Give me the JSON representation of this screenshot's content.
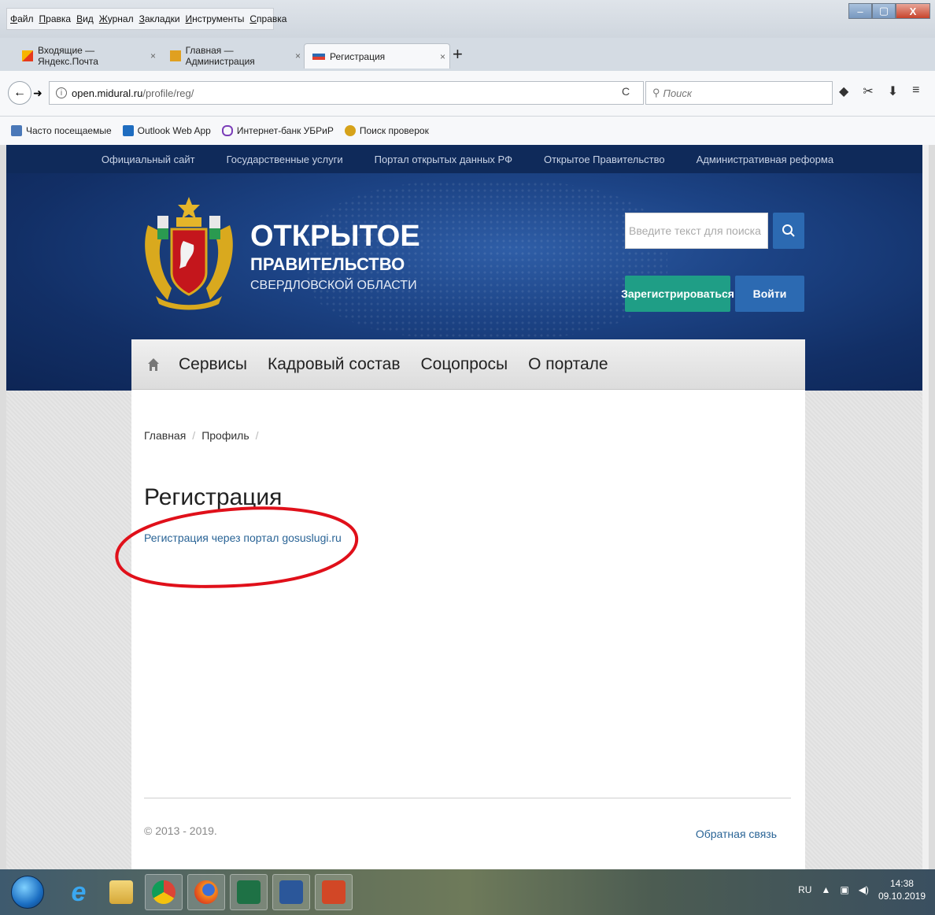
{
  "menu": [
    "Файл",
    "Правка",
    "Вид",
    "Журнал",
    "Закладки",
    "Инструменты",
    "Справка"
  ],
  "tabs": [
    {
      "label": "Входящие — Яндекс.Почта",
      "close": "×"
    },
    {
      "label": "Главная — Администрация",
      "close": "×"
    },
    {
      "label": "Регистрация",
      "close": "×"
    }
  ],
  "new_tab": "+",
  "url": {
    "host": "open.midural.ru",
    "path": "/profile/reg/"
  },
  "search": {
    "placeholder": "Поиск"
  },
  "bookmarks": [
    "Часто посещаемые",
    "Outlook Web App",
    "Интернет-банк УБРиР",
    "Поиск проверок"
  ],
  "topnav": [
    "Официальный сайт",
    "Государственные услуги",
    "Портал открытых данных РФ",
    "Открытое Правительство",
    "Административная реформа"
  ],
  "brand": {
    "title": "ОТКРЫТОЕ",
    "subtitle": "ПРАВИТЕЛЬСТВО",
    "region": "СВЕРДЛОВСКОЙ ОБЛАСТИ"
  },
  "site_search": {
    "placeholder": "Введите текст для поиска"
  },
  "buttons": {
    "register": "Зарегистрироваться",
    "login": "Войти"
  },
  "mainnav": [
    "Сервисы",
    "Кадровый состав",
    "Соцопросы",
    "О портале"
  ],
  "breadcrumb": [
    "Главная",
    "Профиль"
  ],
  "page_title": "Регистрация",
  "reg_link": "Регистрация через портал gosuslugi.ru",
  "footer": {
    "copyright": "© 2013 - 2019.",
    "feedback": "Обратная связь"
  },
  "tray": {
    "lang": "RU",
    "time": "14:38",
    "date": "09.10.2019"
  },
  "colors": {
    "header_dark": "#0f2a5a",
    "register_green": "#1f9e86",
    "primary_blue": "#2c6ab2",
    "annotation_red": "#e0101a",
    "link": "#2a6496"
  }
}
